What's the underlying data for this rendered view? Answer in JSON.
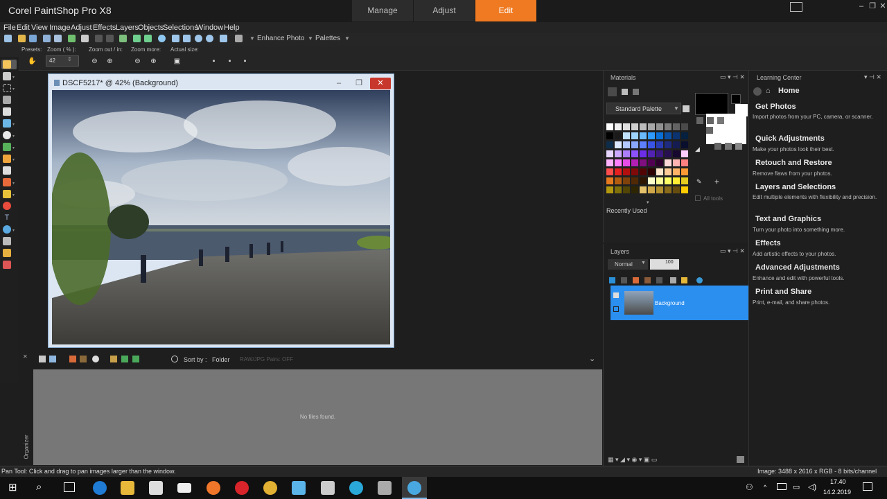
{
  "app": {
    "title": "Corel PaintShop Pro X8"
  },
  "workspace_tabs": [
    {
      "label": "Manage"
    },
    {
      "label": "Adjust"
    },
    {
      "label": "Edit"
    }
  ],
  "menu": [
    "File",
    "Edit",
    "View",
    "Image",
    "Adjust",
    "Effects",
    "Layers",
    "Objects",
    "Selections",
    "Window",
    "Help"
  ],
  "toolbar": {
    "enhance_photo": "Enhance Photo",
    "palettes": "Palettes"
  },
  "tool_options": {
    "presets": "Presets:",
    "zoom": "Zoom ( % ):",
    "zoom_value": "42",
    "zoom_out_in": "Zoom out / in:",
    "zoom_more": "Zoom more:",
    "actual_size": "Actual size:"
  },
  "image_window": {
    "title": "DSCF5217* @  42% (Background)"
  },
  "organizer": {
    "sort_by": "Sort by :",
    "folder": "Folder",
    "raw_pairs": "RAW/JPG Pairs: OFF",
    "no_files": "No files found.",
    "side_label": "Organizer"
  },
  "materials": {
    "title": "Materials",
    "palette": "Standard Palette",
    "all_tools": "All tools",
    "recently_used": "Recently Used"
  },
  "layers": {
    "title": "Layers",
    "blend": "Normal",
    "opacity": "100",
    "layer_name": "Background"
  },
  "learning_center": {
    "title": "Learning Center",
    "home": "Home",
    "items": [
      {
        "title": "Get Photos",
        "desc": "Import photos from your PC, camera, or scanner."
      },
      {
        "title": "Quick Adjustments",
        "desc": "Make your photos look their best."
      },
      {
        "title": "Retouch and Restore",
        "desc": "Remove flaws from your photos."
      },
      {
        "title": "Layers and Selections",
        "desc": "Edit multiple elements with flexibility and precision."
      },
      {
        "title": "Text and Graphics",
        "desc": "Turn your photo into something more."
      },
      {
        "title": "Effects",
        "desc": "Add artistic effects to your photos."
      },
      {
        "title": "Advanced Adjustments",
        "desc": "Enhance and edit with powerful tools."
      },
      {
        "title": "Print and Share",
        "desc": "Print, e-mail, and share photos."
      }
    ]
  },
  "status": {
    "left": "Pan Tool: Click and drag to pan images larger than the window.",
    "right": "Image:  3488 x 2616 x RGB - 8 bits/channel"
  },
  "taskbar": {
    "time": "17.40",
    "date": "14.2.2019"
  },
  "colors": {
    "accent": "#ef7a22",
    "layer_selected": "#2b8ff0"
  }
}
